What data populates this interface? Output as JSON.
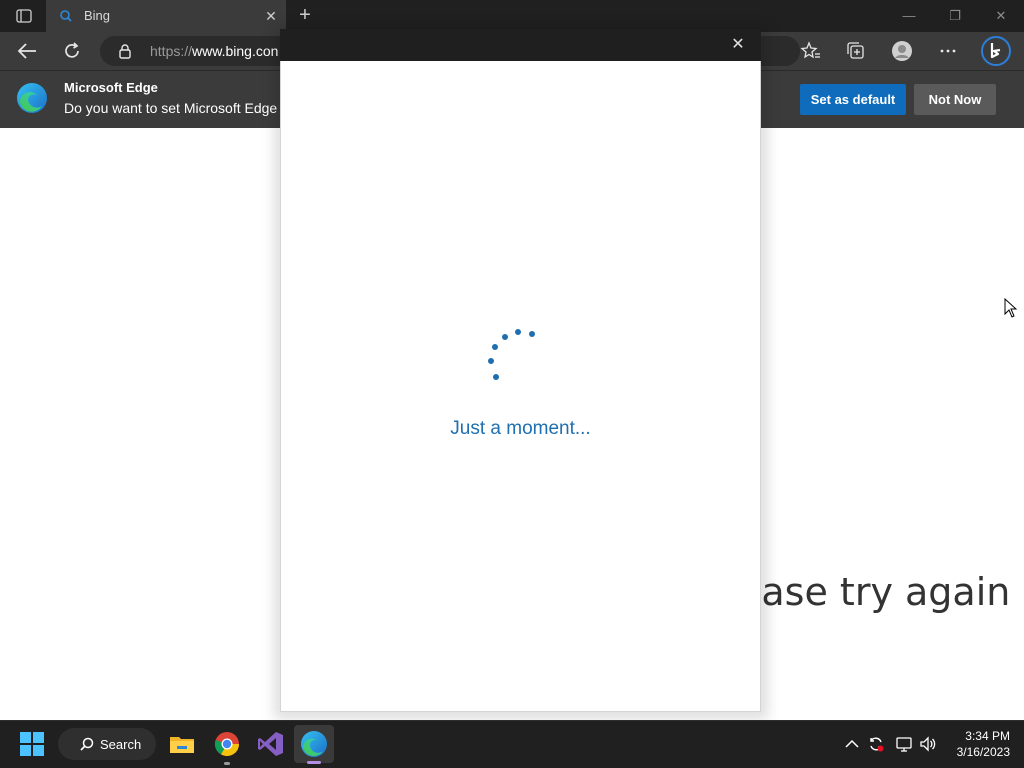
{
  "browser": {
    "tab": {
      "title": "Bing"
    },
    "address": {
      "scheme": "https://",
      "host": "www.bing.con"
    },
    "window_controls": {
      "minimize": "—",
      "restore": "❐",
      "close": "✕"
    }
  },
  "infobar": {
    "title": "Microsoft Edge",
    "message": "Do you want to set Microsoft Edge",
    "set_default_label": "Set as default",
    "not_now_label": "Not Now"
  },
  "page": {
    "error_text": "ease try again"
  },
  "modal": {
    "close_glyph": "✕",
    "loading_text": "Just a moment..."
  },
  "taskbar": {
    "search_label": "Search",
    "clock_time": "3:34 PM",
    "clock_date": "3/16/2023",
    "apps": [
      "file-explorer-icon",
      "chrome-icon",
      "visual-studio-icon",
      "edge-icon"
    ]
  },
  "colors": {
    "accent": "#0f6cbd",
    "loading_blue": "#1f6fb0",
    "taskbar": "#202020",
    "chrome_dark": "#3b3b3b"
  }
}
